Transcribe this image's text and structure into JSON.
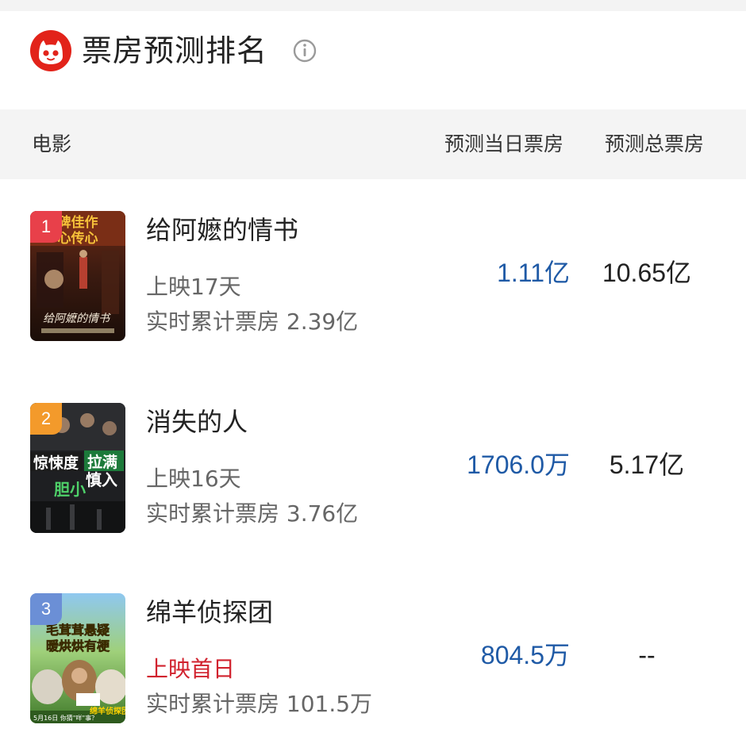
{
  "header": {
    "title": "票房预测排名",
    "logo_icon": "maoyan-cat-logo",
    "info_icon": "info-icon",
    "brand_color": "#e2231a"
  },
  "columns": {
    "movie": "电影",
    "daily": "预测当日票房",
    "total": "预测总票房"
  },
  "movies": [
    {
      "rank": "1",
      "rank_color": "#e8404a",
      "name": "给阿嬷的情书",
      "days": "上映17天",
      "cumulative": "实时累计票房 2.39亿",
      "daily_forecast": "1.11亿",
      "total_forecast": "10.65亿",
      "poster_text": "给阿嬷的情书",
      "poster_banner": "口碑佳作 心传心"
    },
    {
      "rank": "2",
      "rank_color": "#f39a2b",
      "name": "消失的人",
      "days": "上映16天",
      "cumulative": "实时累计票房 3.76亿",
      "daily_forecast": "1706.0万",
      "total_forecast": "5.17亿",
      "poster_text": "惊悚度 胆小 慎入",
      "poster_banner": "拉满"
    },
    {
      "rank": "3",
      "rank_color": "#6b8fd6",
      "name": "绵羊侦探团",
      "days": "上映首日",
      "days_color": "#d1222e",
      "cumulative": "实时累计票房 101.5万",
      "daily_forecast": "804.5万",
      "total_forecast": "--",
      "poster_text": "毛茸茸悬疑 暖烘烘有梗",
      "poster_date": "5月16日 你猜\"咩\"事？",
      "poster_title": "绵羊侦探团"
    }
  ]
}
